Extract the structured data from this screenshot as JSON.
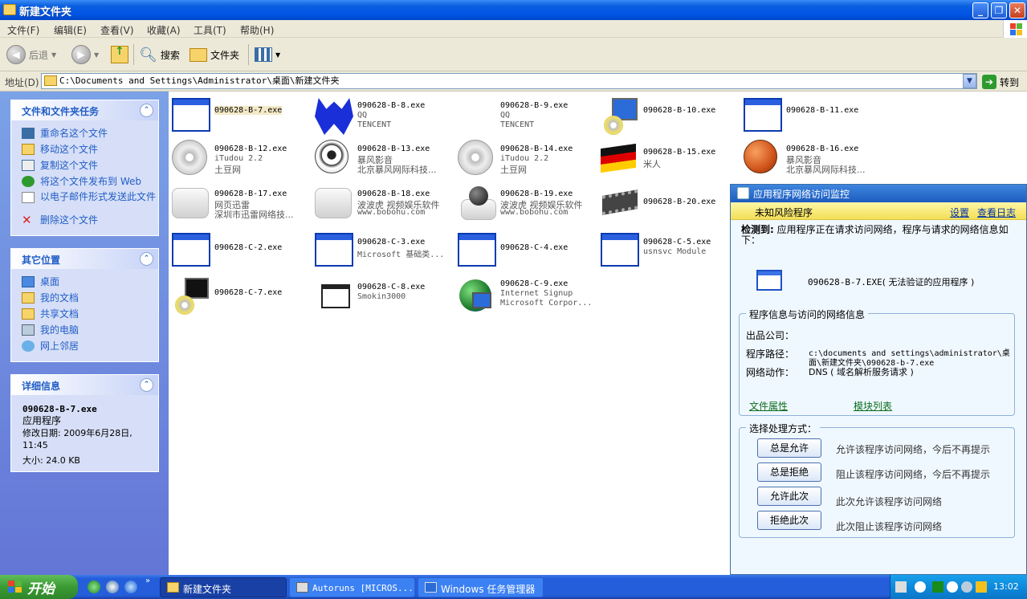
{
  "window": {
    "title": "新建文件夹"
  },
  "menu": [
    "文件(F)",
    "编辑(E)",
    "查看(V)",
    "收藏(A)",
    "工具(T)",
    "帮助(H)"
  ],
  "toolbar": {
    "back": "后退",
    "search": "搜索",
    "folders": "文件夹"
  },
  "address": {
    "label": "地址(D)",
    "path": "C:\\Documents and Settings\\Administrator\\桌面\\新建文件夹",
    "go": "转到"
  },
  "tasks_panel": {
    "title": "文件和文件夹任务",
    "items": [
      "重命名这个文件",
      "移动这个文件",
      "复制这个文件",
      "将这个文件发布到 Web",
      "以电子邮件形式发送此文件",
      "删除这个文件"
    ]
  },
  "places_panel": {
    "title": "其它位置",
    "items": [
      "桌面",
      "我的文档",
      "共享文档",
      "我的电脑",
      "网上邻居"
    ]
  },
  "details_panel": {
    "title": "详细信息",
    "name": "090628-B-7.exe",
    "type": "应用程序",
    "modified": "修改日期: 2009年6月28日, 11:45",
    "size": "大小: 24.0 KB"
  },
  "files": [
    {
      "name": "090628-B-7.exe",
      "l1": "",
      "l2": ""
    },
    {
      "name": "090628-B-8.exe",
      "l1": "QQ",
      "l2": "TENCENT"
    },
    {
      "name": "090628-B-9.exe",
      "l1": "QQ",
      "l2": "TENCENT"
    },
    {
      "name": "090628-B-10.exe",
      "l1": "",
      "l2": ""
    },
    {
      "name": "090628-B-11.exe",
      "l1": "",
      "l2": ""
    },
    {
      "name": "090628-B-12.exe",
      "l1": "iTudou 2.2",
      "l2": "土豆网"
    },
    {
      "name": "090628-B-13.exe",
      "l1": "暴风影音",
      "l2": "北京暴风网际科技..."
    },
    {
      "name": "090628-B-14.exe",
      "l1": "iTudou 2.2",
      "l2": "土豆网"
    },
    {
      "name": "090628-B-15.exe",
      "l1": "米人",
      "l2": ""
    },
    {
      "name": "090628-B-16.exe",
      "l1": "暴风影音",
      "l2": "北京暴风网际科技..."
    },
    {
      "name": "090628-B-17.exe",
      "l1": "网页迅雷",
      "l2": "深圳市迅雷网络技..."
    },
    {
      "name": "090628-B-18.exe",
      "l1": "波波虎 视频娱乐软件",
      "l2": "www.bobohu.com"
    },
    {
      "name": "090628-B-19.exe",
      "l1": "波波虎 视频娱乐软件",
      "l2": "www.bobohu.com"
    },
    {
      "name": "090628-B-20.exe",
      "l1": "",
      "l2": ""
    },
    {
      "name": "090628-C-2.exe",
      "l1": "",
      "l2": ""
    },
    {
      "name": "090628-C-3.exe",
      "l1": "Microsoft 基础类...",
      "l2": ""
    },
    {
      "name": "090628-C-4.exe",
      "l1": "",
      "l2": ""
    },
    {
      "name": "090628-C-5.exe",
      "l1": "usnsvc Module",
      "l2": ""
    },
    {
      "name": "090628-C-7.exe",
      "l1": "",
      "l2": ""
    },
    {
      "name": "090628-C-8.exe",
      "l1": "Smokin3000",
      "l2": ""
    },
    {
      "name": "090628-C-9.exe",
      "l1": "Internet Signup",
      "l2": "Microsoft Corpor..."
    }
  ],
  "monitor": {
    "title": "应用程序网络访问监控",
    "risk": "未知风险程序",
    "settings": "设置",
    "log": "查看日志",
    "detected_label": "检测到:",
    "detected_text": "应用程序正在请求访问网络，程序与请求的网络信息如下：",
    "program": "090628-B-7.EXE",
    "program_note": "( 无法验证的应用程序 )",
    "info_title": "程序信息与访问的网络信息",
    "publisher_label": "出品公司：",
    "path_label": "程序路径：",
    "path_value": "c:\\documents and settings\\administrator\\桌面\\新建文件夹\\090628-b-7.exe",
    "action_label": "网络动作：",
    "action_value": "DNS ( 域名解析服务请求 )",
    "file_props": "文件属性",
    "module_list": "模块列表",
    "choice_title": "选择处理方式：",
    "actions": [
      {
        "btn": "总是允许",
        "desc": "允许该程序访问网络，今后不再提示"
      },
      {
        "btn": "总是拒绝",
        "desc": "阻止该程序访问网络，今后不再提示"
      },
      {
        "btn": "允许此次",
        "desc": "此次允许该程序访问网络"
      },
      {
        "btn": "拒绝此次",
        "desc": "此次阻止该程序访问网络"
      }
    ]
  },
  "taskbar": {
    "start": "开始",
    "tasks": [
      "新建文件夹",
      "Autoruns [MICROS...",
      "Windows 任务管理器"
    ],
    "clock": "13:02"
  }
}
